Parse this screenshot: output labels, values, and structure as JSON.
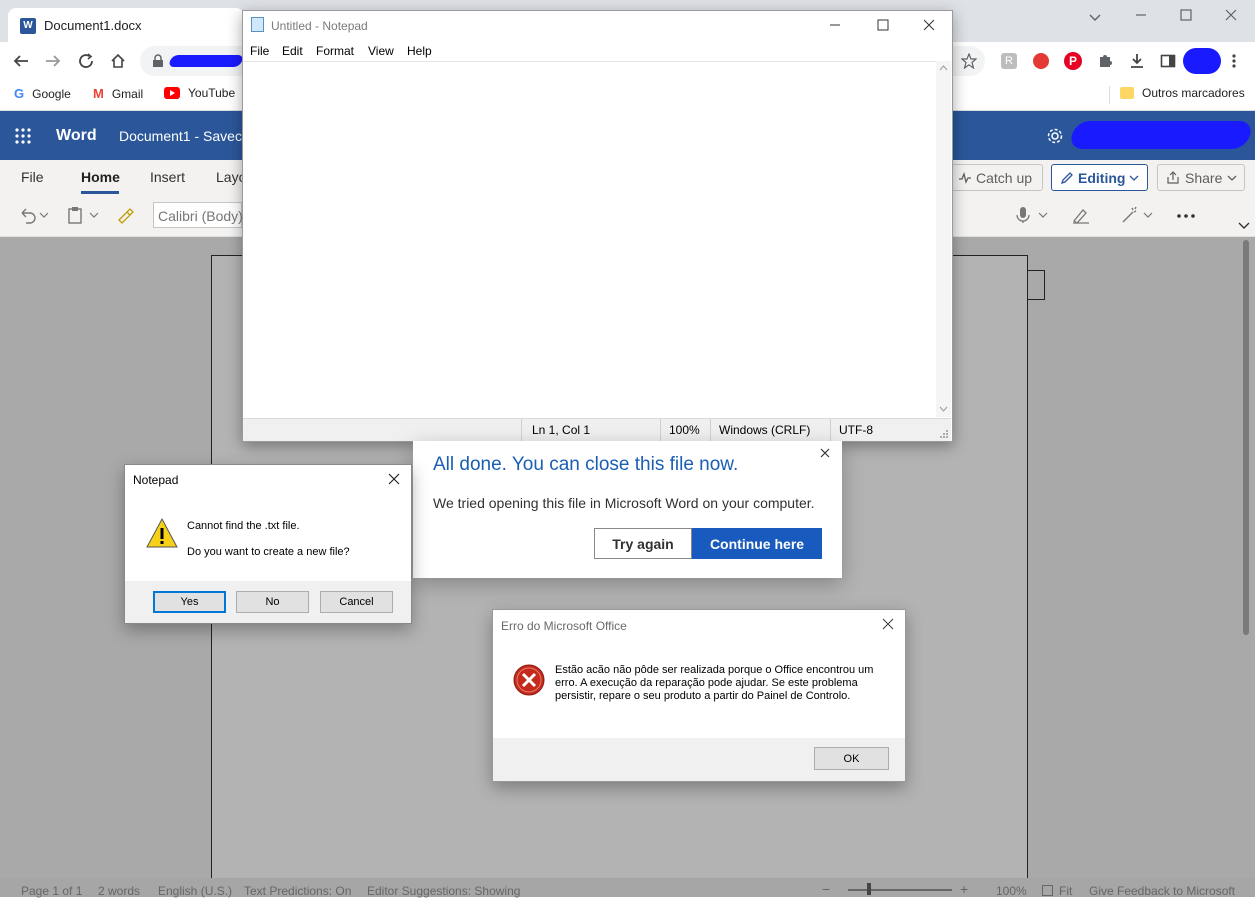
{
  "browser": {
    "tab_title": "Document1.docx",
    "bookmarks": [
      "Google",
      "Gmail",
      "YouTube"
    ],
    "other_bookmarks": "Outros marcadores"
  },
  "word": {
    "app_name": "Word",
    "doc_title": "Document1 - Savec",
    "tabs": [
      "File",
      "Home",
      "Insert",
      "Layo"
    ],
    "active_tab": "Home",
    "font_name": "Calibri (Body)",
    "catch_up": "Catch up",
    "editing": "Editing",
    "share": "Share",
    "status": {
      "page": "Page 1 of 1",
      "words": "2 words",
      "language": "English (U.S.)",
      "text_predictions": "Text Predictions: On",
      "editor_suggestions": "Editor Suggestions: Showing",
      "zoom": "100%",
      "fit": "Fit",
      "feedback": "Give Feedback to Microsoft"
    }
  },
  "notepad": {
    "title": "Untitled - Notepad",
    "menu": [
      "File",
      "Edit",
      "Format",
      "View",
      "Help"
    ],
    "status": {
      "position": "Ln 1, Col 1",
      "zoom": "100%",
      "line_ending": "Windows (CRLF)",
      "encoding": "UTF-8"
    }
  },
  "word_dialog": {
    "heading": "All done. You can close this file now.",
    "body": "We tried opening this file in Microsoft Word on your computer.",
    "try_again": "Try again",
    "continue_here": "Continue here"
  },
  "notepad_msg": {
    "title": "Notepad",
    "line1": "Cannot find the .txt file.",
    "line2": "Do you want to create a new file?",
    "yes": "Yes",
    "no": "No",
    "cancel": "Cancel"
  },
  "office_error": {
    "title": "Erro do Microsoft Office",
    "message": "Estão acão não pôde ser realizada porque o Office encontrou um erro. A execução da reparação pode ajudar. Se este problema persistir, repare o seu produto a partir do Painel de Controlo.",
    "ok": "OK"
  },
  "colors": {
    "word_blue": "#2b579a",
    "primary_button": "#185abd",
    "heading_blue": "#1a5fb4",
    "error_red": "#c42b1c",
    "warning_yellow": "#f7d117"
  }
}
